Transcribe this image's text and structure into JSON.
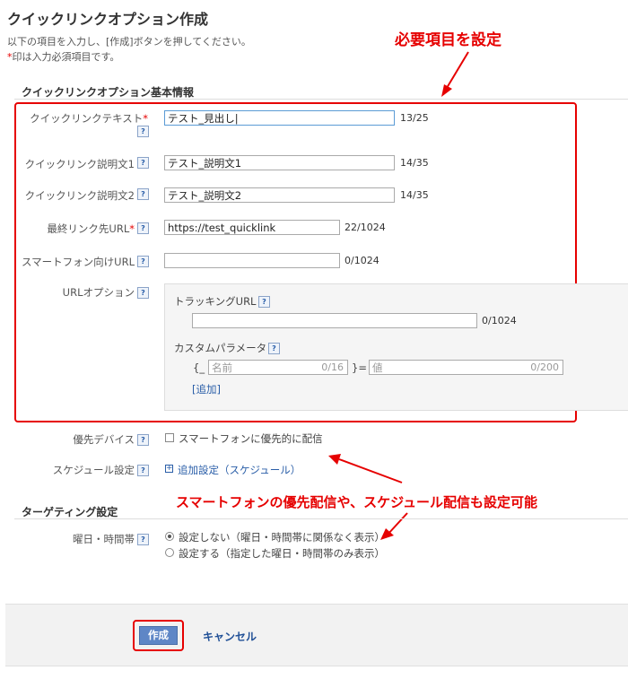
{
  "page": {
    "title": "クイックリンクオプション作成",
    "intro_line1": "以下の項目を入力し、[作成]ボタンを押してください。",
    "intro_req_mark": "*",
    "intro_line2": "印は入力必須項目です。"
  },
  "basic_section": {
    "title": "クイックリンクオプション基本情報",
    "fields": {
      "link_text": {
        "label": "クイックリンクテキスト",
        "required_mark": "*",
        "value": "テスト_見出し",
        "count": "13/25"
      },
      "desc1": {
        "label": "クイックリンク説明文1",
        "value": "テスト_説明文1",
        "count": "14/35"
      },
      "desc2": {
        "label": "クイックリンク説明文2",
        "value": "テスト_説明文2",
        "count": "14/35"
      },
      "final_url": {
        "label": "最終リンク先URL",
        "required_mark": "*",
        "value": "https://test_quicklink",
        "count": "22/1024"
      },
      "mobile_url": {
        "label": "スマートフォン向けURL",
        "value": "",
        "count": "0/1024"
      },
      "url_options": {
        "label": "URLオプション",
        "tracking_label": "トラッキングURL",
        "tracking_value": "",
        "tracking_count": "0/1024",
        "custom_param_label": "カスタムパラメータ",
        "param_prefix": "{_",
        "param_name_placeholder": "名前",
        "param_name_count": "0/16",
        "param_eq": "}=",
        "param_value_placeholder": "値",
        "param_value_count": "0/200",
        "add_link": "[追加]"
      }
    }
  },
  "device": {
    "label": "優先デバイス",
    "checkbox_label": "スマートフォンに優先的に配信",
    "checked": false
  },
  "schedule": {
    "label": "スケジュール設定",
    "link": "追加設定（スケジュール）"
  },
  "targeting_section": {
    "title": "ターゲティング設定",
    "day_time": {
      "label": "曜日・時間帯",
      "options": [
        {
          "label": "設定しない（曜日・時間帯に関係なく表示）",
          "selected": true
        },
        {
          "label": "設定する（指定した曜日・時間帯のみ表示）",
          "selected": false
        }
      ]
    }
  },
  "actions": {
    "create": "作成",
    "cancel": "キャンセル"
  },
  "annotations": {
    "required_items": "必要項目を設定",
    "mobile_schedule": "スマートフォンの優先配信や、スケジュール配信も設定可能"
  },
  "colors": {
    "accent_red": "#e60000",
    "link_blue": "#2a5ea8",
    "button_blue": "#5e86c6"
  },
  "icons": {
    "help": "help-icon",
    "plus": "plus-box-icon"
  }
}
